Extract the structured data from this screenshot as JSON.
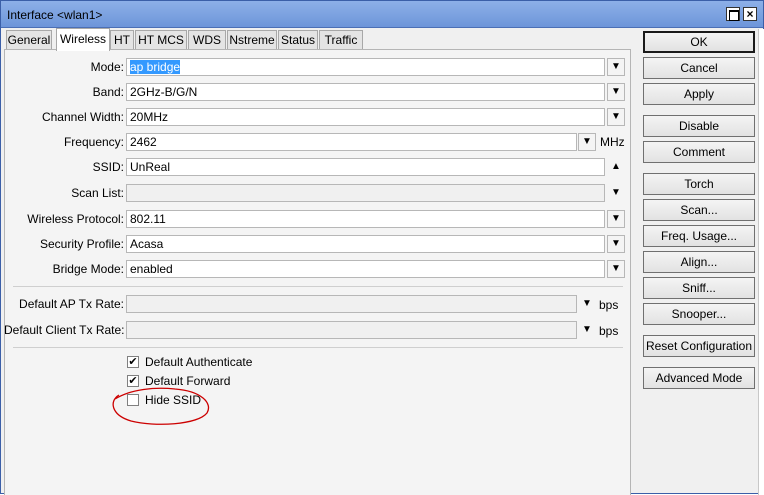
{
  "window": {
    "title": "Interface <wlan1>"
  },
  "tabs": [
    "General",
    "Wireless",
    "HT",
    "HT MCS",
    "WDS",
    "Nstreme",
    "Status",
    "Traffic"
  ],
  "form": {
    "mode": {
      "label": "Mode:",
      "value": "ap bridge"
    },
    "band": {
      "label": "Band:",
      "value": "2GHz-B/G/N"
    },
    "channel_width": {
      "label": "Channel Width:",
      "value": "20MHz"
    },
    "frequency": {
      "label": "Frequency:",
      "value": "2462",
      "unit": "MHz"
    },
    "ssid": {
      "label": "SSID:",
      "value": "UnReal"
    },
    "scan_list": {
      "label": "Scan List:",
      "value": ""
    },
    "wireless_protocol": {
      "label": "Wireless Protocol:",
      "value": "802.11"
    },
    "security_profile": {
      "label": "Security Profile:",
      "value": "Acasa"
    },
    "bridge_mode": {
      "label": "Bridge Mode:",
      "value": "enabled"
    },
    "default_ap_tx_rate": {
      "label": "Default AP Tx Rate:",
      "value": "",
      "unit": "bps"
    },
    "default_client_tx_rate": {
      "label": "Default Client Tx Rate:",
      "value": "",
      "unit": "bps"
    }
  },
  "checkboxes": [
    {
      "label": "Default Authenticate",
      "checked": true
    },
    {
      "label": "Default Forward",
      "checked": true
    },
    {
      "label": "Hide SSID",
      "checked": false
    }
  ],
  "buttons": {
    "ok": "OK",
    "cancel": "Cancel",
    "apply": "Apply",
    "disable": "Disable",
    "comment": "Comment",
    "torch": "Torch",
    "scan": "Scan...",
    "freq_usage": "Freq. Usage...",
    "align": "Align...",
    "sniff": "Sniff...",
    "snooper": "Snooper...",
    "reset_configuration": "Reset Configuration",
    "advanced_mode": "Advanced Mode"
  },
  "icons": {
    "dropdown": "▼",
    "up": "▲",
    "check": "✔",
    "close": "×"
  },
  "colors": {
    "titlebar": "#7aa0e0",
    "selection": "#3399ff",
    "annotation": "#cc0000"
  }
}
